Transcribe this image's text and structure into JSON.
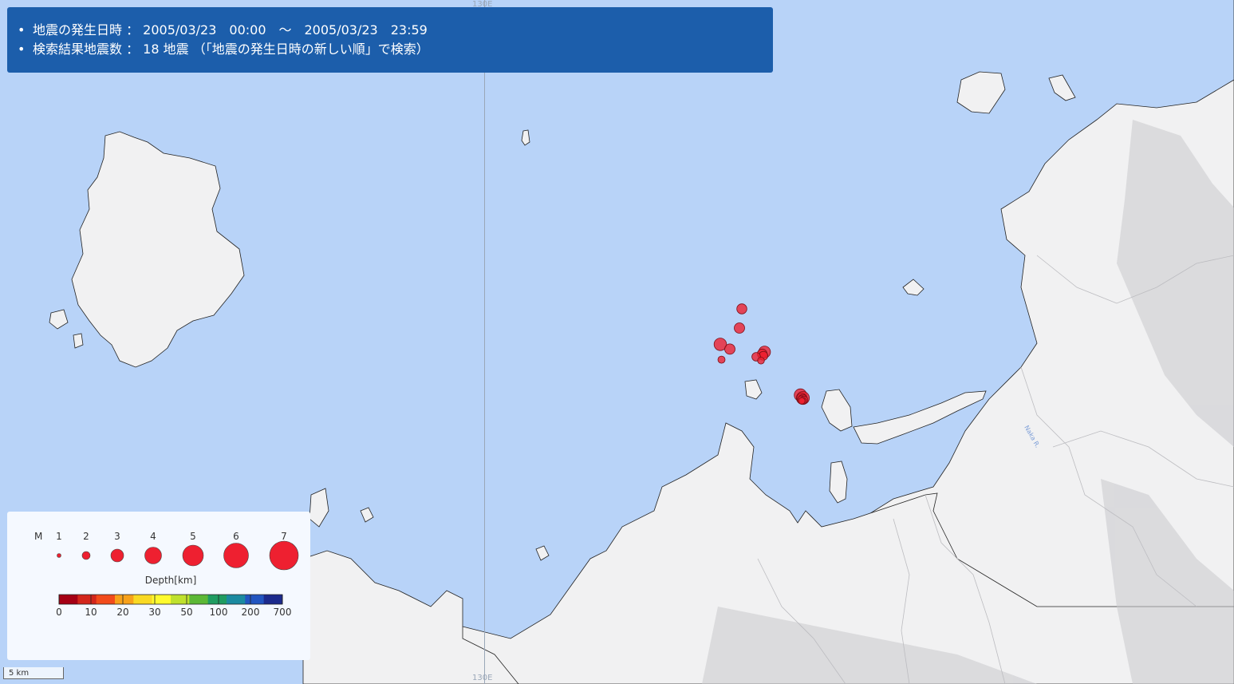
{
  "header": {
    "line1": "地震の発生日時 ： 2005/03/23　00:00　～　2005/03/23　23:59",
    "line2": "検索結果地震数 ： 18 地震 （「地震の発生日時の新しい順」で検索）"
  },
  "map": {
    "meridian_label": "130E",
    "scale_label": "5 km",
    "river_label": "Naka R."
  },
  "legend": {
    "magnitude_label": "M",
    "magnitudes": [
      "1",
      "2",
      "3",
      "4",
      "5",
      "6",
      "7"
    ],
    "depth_title": "Depth[km]",
    "depth_ticks": [
      "0",
      "10",
      "20",
      "30",
      "50",
      "100",
      "200",
      "700"
    ],
    "depth_colors": [
      "#a50014",
      "#d3261b",
      "#f24b1b",
      "#f7a11a",
      "#f9d923",
      "#fffb2e",
      "#bfe12d",
      "#5cb836",
      "#1f9c61",
      "#1b8aa0",
      "#2255c0",
      "#1c2a8c"
    ],
    "marker_color": "#ee2030"
  },
  "earthquakes": [
    {
      "lat": 33.755,
      "lon": 130.215,
      "magnitude": 2.5,
      "depth_km": 8
    },
    {
      "lat": 33.735,
      "lon": 130.213,
      "magnitude": 2.6,
      "depth_km": 8
    },
    {
      "lat": 33.718,
      "lon": 130.197,
      "magnitude": 3.2,
      "depth_km": 8
    },
    {
      "lat": 33.713,
      "lon": 130.205,
      "magnitude": 2.6,
      "depth_km": 8
    },
    {
      "lat": 33.71,
      "lon": 130.234,
      "magnitude": 3.0,
      "depth_km": 8
    },
    {
      "lat": 33.708,
      "lon": 130.232,
      "magnitude": 2.4,
      "depth_km": 8
    },
    {
      "lat": 33.706,
      "lon": 130.233,
      "magnitude": 2.2,
      "depth_km": 8
    },
    {
      "lat": 33.705,
      "lon": 130.227,
      "magnitude": 2.1,
      "depth_km": 8
    },
    {
      "lat": 33.702,
      "lon": 130.198,
      "magnitude": 1.7,
      "depth_km": 8
    },
    {
      "lat": 33.701,
      "lon": 130.231,
      "magnitude": 1.6,
      "depth_km": 8
    },
    {
      "lat": 33.665,
      "lon": 130.264,
      "magnitude": 3.2,
      "depth_km": 10
    },
    {
      "lat": 33.662,
      "lon": 130.266,
      "magnitude": 3.3,
      "depth_km": 10
    },
    {
      "lat": 33.662,
      "lon": 130.265,
      "magnitude": 2.4,
      "depth_km": 10
    },
    {
      "lat": 33.661,
      "lon": 130.266,
      "magnitude": 2.2,
      "depth_km": 10
    },
    {
      "lat": 33.66,
      "lon": 130.265,
      "magnitude": 2.0,
      "depth_km": 10
    },
    {
      "lat": 33.66,
      "lon": 130.267,
      "magnitude": 1.8,
      "depth_km": 10
    },
    {
      "lat": 33.659,
      "lon": 130.266,
      "magnitude": 1.6,
      "depth_km": 10
    },
    {
      "lat": 33.659,
      "lon": 130.265,
      "magnitude": 1.5,
      "depth_km": 10
    }
  ]
}
